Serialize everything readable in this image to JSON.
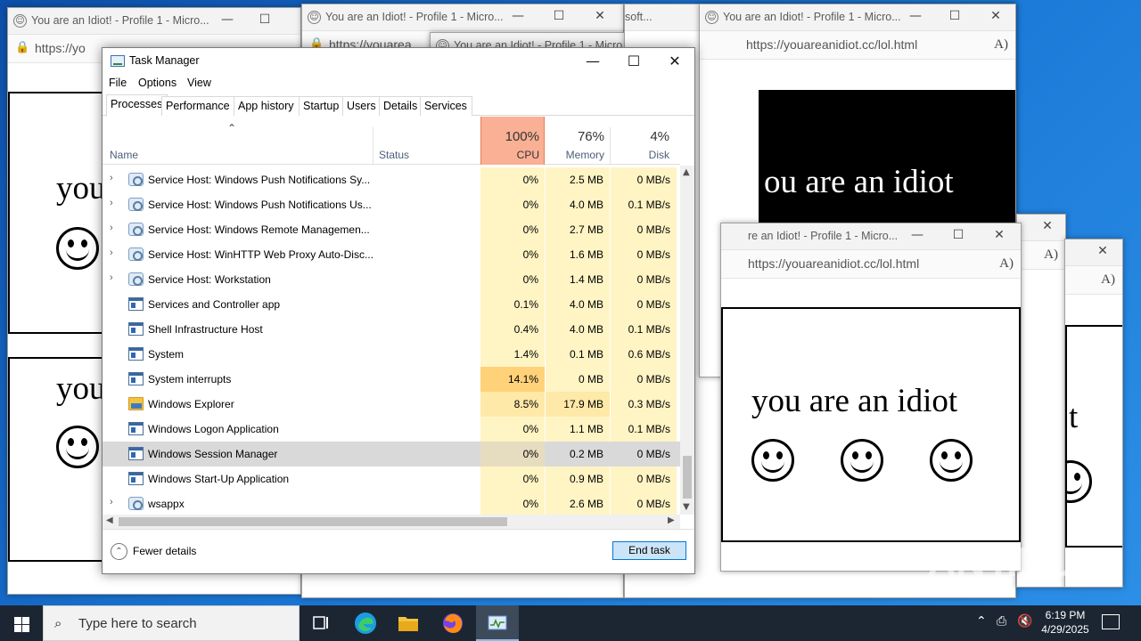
{
  "edge": {
    "title": "You are an Idiot! - Profile 1 - Micro...",
    "title_short": "re an Idiot! - Profile 1 - Micro...",
    "title_clip": "soft...",
    "url_full": "https://youareanidiot.cc/lol.html",
    "url_clip1": "https://yo",
    "url_clip2": "https://youarea",
    "minimize": "—",
    "maximize": "☐",
    "close": "✕",
    "read_aloud": "A)",
    "message": "you are an idiot",
    "message_clip": "you",
    "message_clip2": "t",
    "message_clip3": "ou are an idiot"
  },
  "taskmanager": {
    "title": "Task Manager",
    "menu": [
      "File",
      "Options",
      "View"
    ],
    "tabs": [
      "Processes",
      "Performance",
      "App history",
      "Startup",
      "Users",
      "Details",
      "Services"
    ],
    "active_tab": "Processes",
    "columns": {
      "name": "Name",
      "status": "Status",
      "cpu_pct": "100%",
      "cpu": "CPU",
      "mem_pct": "76%",
      "mem": "Memory",
      "disk_pct": "4%",
      "disk": "Disk"
    },
    "processes": [
      {
        "name": "Service Host: Windows Push Notifications Sy...",
        "icon": "gear-icon",
        "expandable": true,
        "cpu": "0%",
        "memory": "2.5 MB",
        "disk": "0 MB/s"
      },
      {
        "name": "Service Host: Windows Push Notifications Us...",
        "icon": "gear-icon",
        "expandable": true,
        "cpu": "0%",
        "memory": "4.0 MB",
        "disk": "0.1 MB/s"
      },
      {
        "name": "Service Host: Windows Remote Managemen...",
        "icon": "gear-icon",
        "expandable": true,
        "cpu": "0%",
        "memory": "2.7 MB",
        "disk": "0 MB/s"
      },
      {
        "name": "Service Host: WinHTTP Web Proxy Auto-Disc...",
        "icon": "gear-icon",
        "expandable": true,
        "cpu": "0%",
        "memory": "1.6 MB",
        "disk": "0 MB/s"
      },
      {
        "name": "Service Host: Workstation",
        "icon": "gear-icon",
        "expandable": true,
        "cpu": "0%",
        "memory": "1.4 MB",
        "disk": "0 MB/s"
      },
      {
        "name": "Services and Controller app",
        "icon": "window-icon",
        "expandable": false,
        "cpu": "0.1%",
        "memory": "4.0 MB",
        "disk": "0 MB/s"
      },
      {
        "name": "Shell Infrastructure Host",
        "icon": "window-icon",
        "expandable": false,
        "cpu": "0.4%",
        "memory": "4.0 MB",
        "disk": "0.1 MB/s"
      },
      {
        "name": "System",
        "icon": "window-icon",
        "expandable": false,
        "cpu": "1.4%",
        "memory": "0.1 MB",
        "disk": "0.6 MB/s"
      },
      {
        "name": "System interrupts",
        "icon": "window-icon",
        "expandable": false,
        "cpu": "14.1%",
        "memory": "0 MB",
        "disk": "0 MB/s"
      },
      {
        "name": "Windows Explorer",
        "icon": "folder-icon",
        "expandable": false,
        "cpu": "8.5%",
        "memory": "17.9 MB",
        "disk": "0.3 MB/s"
      },
      {
        "name": "Windows Logon Application",
        "icon": "window-icon",
        "expandable": false,
        "cpu": "0%",
        "memory": "1.1 MB",
        "disk": "0.1 MB/s"
      },
      {
        "name": "Windows Session Manager",
        "icon": "window-icon",
        "expandable": false,
        "cpu": "0%",
        "memory": "0.2 MB",
        "disk": "0 MB/s",
        "selected": true
      },
      {
        "name": "Windows Start-Up Application",
        "icon": "window-icon",
        "expandable": false,
        "cpu": "0%",
        "memory": "0.9 MB",
        "disk": "0 MB/s"
      },
      {
        "name": "wsappx",
        "icon": "gear-icon",
        "expandable": true,
        "cpu": "0%",
        "memory": "2.6 MB",
        "disk": "0 MB/s"
      }
    ],
    "fewer_details": "Fewer details",
    "end_task": "End task"
  },
  "taskbar": {
    "search_placeholder": "Type here to search",
    "time": "6:19 PM",
    "date": "4/29/2025"
  },
  "watermark": "ANY.RUN",
  "colors": {
    "cpu_header": "#f9b094",
    "heat_low": "#fff4c4",
    "heat_mid": "#ffe9a8",
    "heat_high": "#ffd27a",
    "selected_row": "#d9d9d9",
    "taskbar": "#1c2633",
    "desktop": "#1a78d6"
  }
}
